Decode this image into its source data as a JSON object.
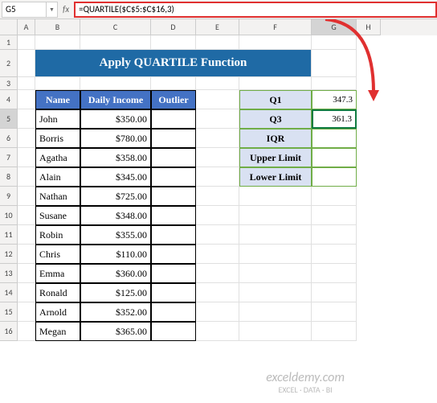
{
  "namebox": "G5",
  "fx": "fx",
  "formula": "=QUARTILE($C$5:$C$16,3)",
  "cols": [
    "A",
    "B",
    "C",
    "D",
    "E",
    "F",
    "G",
    "H"
  ],
  "rows": [
    "1",
    "2",
    "3",
    "4",
    "5",
    "6",
    "7",
    "8",
    "9",
    "10",
    "11",
    "12",
    "13",
    "14",
    "15",
    "16"
  ],
  "title": "Apply QUARTILE Function",
  "headers": {
    "name": "Name",
    "income": "Daily Income",
    "outlier": "Outlier"
  },
  "people": [
    {
      "n": "John",
      "i": "$350.00"
    },
    {
      "n": "Borris",
      "i": "$780.00"
    },
    {
      "n": "Agatha",
      "i": "$358.00"
    },
    {
      "n": "Alain",
      "i": "$345.00"
    },
    {
      "n": "Nathan",
      "i": "$725.00"
    },
    {
      "n": "Susane",
      "i": "$348.00"
    },
    {
      "n": "Robin",
      "i": "$355.00"
    },
    {
      "n": "Chris",
      "i": "$110.00"
    },
    {
      "n": "Emma",
      "i": "$360.00"
    },
    {
      "n": "Ronald",
      "i": "$125.00"
    },
    {
      "n": "Arnold",
      "i": "$352.00"
    },
    {
      "n": "Megan",
      "i": "$365.00"
    }
  ],
  "calc": [
    {
      "l": "Q1",
      "v": "347.3"
    },
    {
      "l": "Q3",
      "v": "361.3"
    },
    {
      "l": "IQR",
      "v": ""
    },
    {
      "l": "Upper Limit",
      "v": ""
    },
    {
      "l": "Lower Limit",
      "v": ""
    }
  ],
  "watermark": {
    "main": "exceldemy.com",
    "sub": "EXCEL · DATA · BI"
  },
  "chart_data": {
    "type": "table",
    "title": "Apply QUARTILE Function",
    "columns": [
      "Name",
      "Daily Income",
      "Outlier"
    ],
    "rows": [
      [
        "John",
        350.0,
        null
      ],
      [
        "Borris",
        780.0,
        null
      ],
      [
        "Agatha",
        358.0,
        null
      ],
      [
        "Alain",
        345.0,
        null
      ],
      [
        "Nathan",
        725.0,
        null
      ],
      [
        "Susane",
        348.0,
        null
      ],
      [
        "Robin",
        355.0,
        null
      ],
      [
        "Chris",
        110.0,
        null
      ],
      [
        "Emma",
        360.0,
        null
      ],
      [
        "Ronald",
        125.0,
        null
      ],
      [
        "Arnold",
        352.0,
        null
      ],
      [
        "Megan",
        365.0,
        null
      ]
    ],
    "calculations": {
      "Q1": 347.3,
      "Q3": 361.3,
      "IQR": null,
      "Upper Limit": null,
      "Lower Limit": null
    },
    "formula": "=QUARTILE($C$5:$C$16,3)"
  }
}
